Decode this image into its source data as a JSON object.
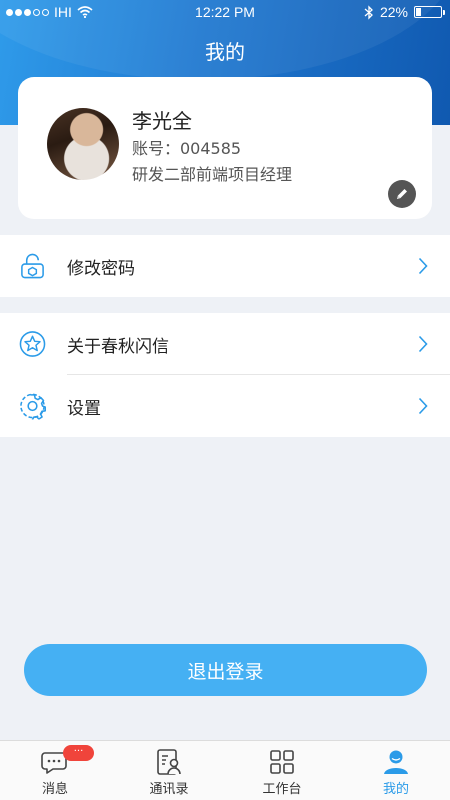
{
  "status_bar": {
    "carrier": "IHI",
    "time": "12:22 PM",
    "battery": "22%",
    "battery_level": 0.22
  },
  "header": {
    "title": "我的"
  },
  "profile": {
    "name": "李光全",
    "account": "账号：004585",
    "position": "研发二部前端项目经理"
  },
  "menu": {
    "group1": [
      {
        "label": "修改密码",
        "icon": "lock-icon"
      }
    ],
    "group2": [
      {
        "label": "关于春秋闪信",
        "icon": "star-icon"
      },
      {
        "label": "设置",
        "icon": "gear-icon"
      }
    ]
  },
  "logout": {
    "label": "退出登录"
  },
  "tabbar": {
    "items": [
      {
        "label": "消息",
        "icon": "chat-icon",
        "badge": "···"
      },
      {
        "label": "通讯录",
        "icon": "contacts-icon"
      },
      {
        "label": "工作台",
        "icon": "grid-icon"
      },
      {
        "label": "我的",
        "icon": "profile-icon",
        "active": true
      }
    ]
  },
  "colors": {
    "accent": "#2b9be8",
    "logout_button": "#45b0f3",
    "header_start": "#2f9bea",
    "header_end": "#1059b0",
    "badge": "#f0443b"
  }
}
